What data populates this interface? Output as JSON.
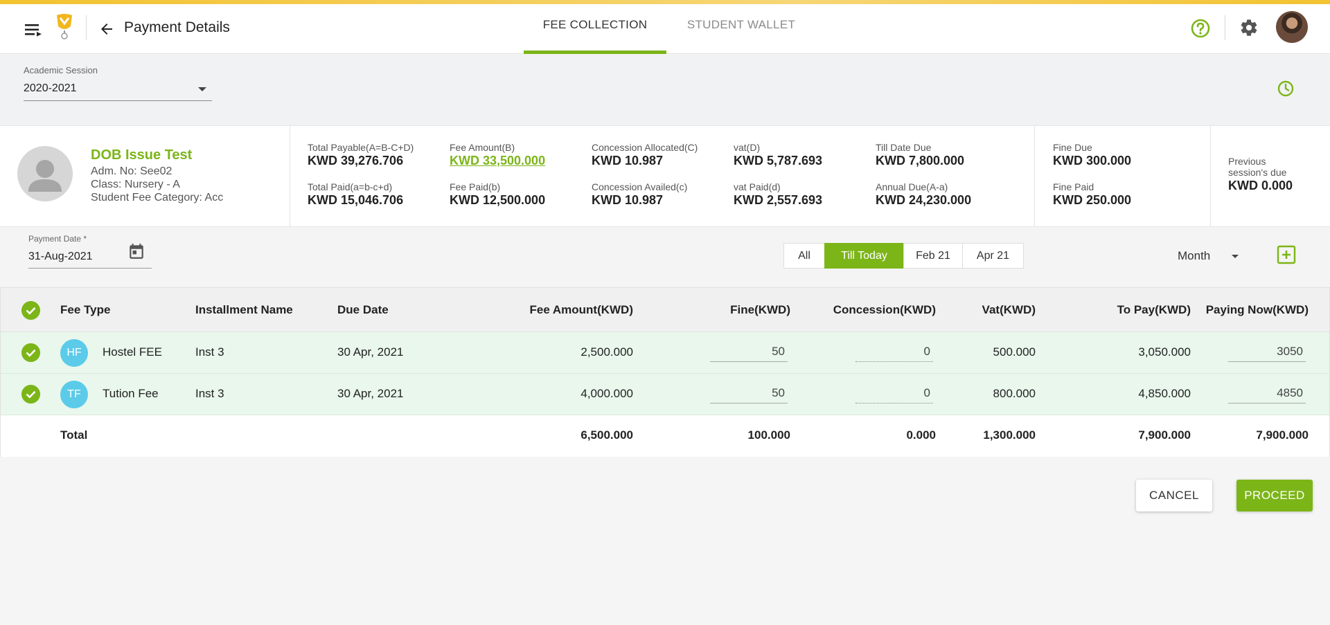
{
  "header": {
    "title": "Payment Details",
    "tabs": [
      {
        "label": "FEE COLLECTION",
        "active": true
      },
      {
        "label": "STUDENT WALLET",
        "active": false
      }
    ],
    "accent_color": "#7cb518"
  },
  "session": {
    "label": "Academic Session",
    "value": "2020-2021"
  },
  "student": {
    "name": "DOB Issue Test",
    "admission": "Adm. No: See02",
    "class": "Class: Nursery - A",
    "category": "Student Fee Category: Acc"
  },
  "stats": {
    "total_payable_label": "Total Payable(A=B-C+D)",
    "total_payable": "KWD 39,276.706",
    "total_paid_label": "Total Paid(a=b-c+d)",
    "total_paid": "KWD 15,046.706",
    "fee_amount_label": "Fee Amount(B)",
    "fee_amount": "KWD 33,500.000",
    "fee_paid_label": "Fee Paid(b)",
    "fee_paid": "KWD 12,500.000",
    "concession_alloc_label": "Concession Allocated(C)",
    "concession_alloc": "KWD 10.987",
    "concession_avail_label": "Concession Availed(c)",
    "concession_avail": "KWD 10.987",
    "vat_label": "vat(D)",
    "vat": "KWD 5,787.693",
    "vat_paid_label": "vat Paid(d)",
    "vat_paid": "KWD 2,557.693",
    "till_date_due_label": "Till Date Due",
    "till_date_due": "KWD 7,800.000",
    "annual_due_label": "Annual Due(A-a)",
    "annual_due": "KWD 24,230.000",
    "fine_due_label": "Fine Due",
    "fine_due": "KWD 300.000",
    "fine_paid_label": "Fine Paid",
    "fine_paid": "KWD 250.000",
    "prev_due_label_1": "Previous",
    "prev_due_label_2": "session's due",
    "prev_due": "KWD 0.000"
  },
  "filters": {
    "payment_date_label": "Payment Date *",
    "payment_date": "31-Aug-2021",
    "segments": [
      "All",
      "Till Today",
      "Feb 21",
      "Apr 21"
    ],
    "active_segment": "Till Today",
    "month": "Month"
  },
  "table": {
    "columns": [
      "Fee Type",
      "Installment Name",
      "Due Date",
      "Fee Amount(KWD)",
      "Fine(KWD)",
      "Concession(KWD)",
      "Vat(KWD)",
      "To Pay(KWD)",
      "Paying Now(KWD)"
    ],
    "rows": [
      {
        "initials": "HF",
        "fee_type": "Hostel FEE",
        "installment": "Inst 3",
        "due_date": "30 Apr, 2021",
        "fee_amount": "2,500.000",
        "fine": "50",
        "concession": "0",
        "vat": "500.000",
        "to_pay": "3,050.000",
        "paying_now": "3050"
      },
      {
        "initials": "TF",
        "fee_type": "Tution Fee",
        "installment": "Inst 3",
        "due_date": "30 Apr, 2021",
        "fee_amount": "4,000.000",
        "fine": "50",
        "concession": "0",
        "vat": "800.000",
        "to_pay": "4,850.000",
        "paying_now": "4850"
      }
    ],
    "total": {
      "label": "Total",
      "fee_amount": "6,500.000",
      "fine": "100.000",
      "concession": "0.000",
      "vat": "1,300.000",
      "to_pay": "7,900.000",
      "paying_now": "7,900.000"
    }
  },
  "actions": {
    "cancel": "CANCEL",
    "proceed": "PROCEED"
  }
}
